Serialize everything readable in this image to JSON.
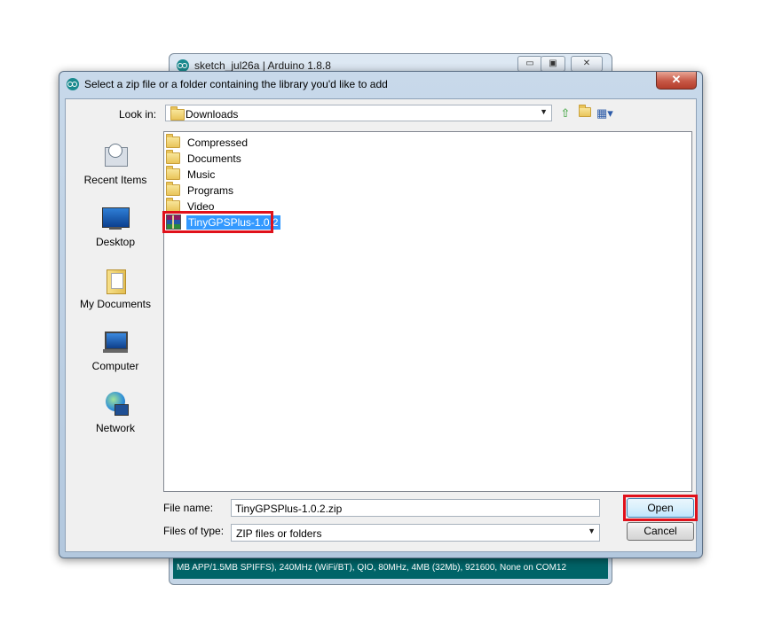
{
  "background_window": {
    "title": "sketch_jul26a | Arduino 1.8.8",
    "controls": [
      "▭",
      "▣",
      "✕"
    ],
    "status_text": "MB APP/1.5MB SPIFFS), 240MHz (WiFi/BT), QIO, 80MHz, 4MB (32Mb), 921600, None on COM12"
  },
  "dialog": {
    "title": "Select a zip file or a folder containing the library you'd like to add",
    "close_glyph": "✕",
    "look_in_label": "Look in:",
    "look_in_value": "Downloads",
    "places": [
      {
        "label": "Recent Items"
      },
      {
        "label": "Desktop"
      },
      {
        "label": "My Documents"
      },
      {
        "label": "Computer"
      },
      {
        "label": "Network"
      }
    ],
    "files": [
      {
        "name": "Compressed",
        "type": "folder"
      },
      {
        "name": "Documents",
        "type": "folder"
      },
      {
        "name": "Music",
        "type": "folder"
      },
      {
        "name": "Programs",
        "type": "folder"
      },
      {
        "name": "Video",
        "type": "folder"
      },
      {
        "name": "TinyGPSPlus-1.0.2",
        "type": "zip",
        "selected": true
      }
    ],
    "file_name_label": "File name:",
    "file_name_value": "TinyGPSPlus-1.0.2.zip",
    "file_type_label": "Files of type:",
    "file_type_value": "ZIP files or folders",
    "open_label": "Open",
    "cancel_label": "Cancel",
    "highlight_color": "#e0111b",
    "selection_color": "#3399ff"
  }
}
